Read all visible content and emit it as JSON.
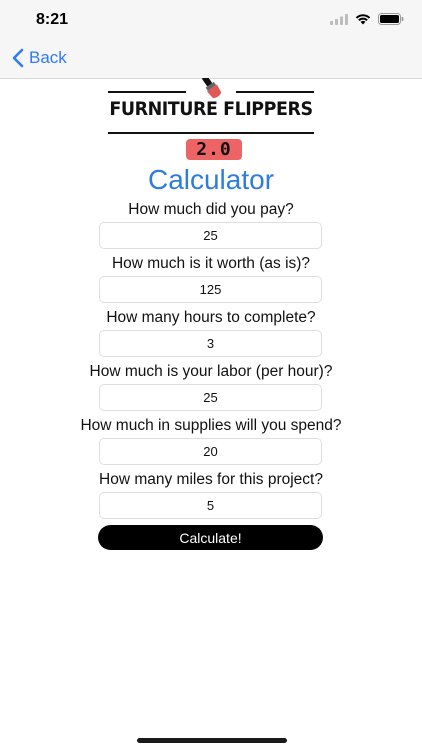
{
  "status_bar": {
    "time": "8:21",
    "icons": [
      "cellular-signal-icon",
      "wifi-icon",
      "battery-icon"
    ]
  },
  "nav": {
    "back_label": "Back"
  },
  "logo": {
    "title": "FURNITURE FLIPPERS",
    "version": "2.0"
  },
  "page": {
    "title": "Calculator"
  },
  "fields": [
    {
      "label": "How much did you pay?",
      "value": "25"
    },
    {
      "label": "How much is it worth (as is)?",
      "value": "125"
    },
    {
      "label": "How many hours to complete?",
      "value": "3"
    },
    {
      "label": "How much is your labor (per hour)?",
      "value": "25"
    },
    {
      "label": "How much in supplies will you spend?",
      "value": "20"
    },
    {
      "label": "How many miles for this project?",
      "value": "5"
    }
  ],
  "actions": {
    "calculate_label": "Calculate!"
  },
  "colors": {
    "accent": "#2f7bf5",
    "title": "#2f7ddb",
    "badge": "#ee6465",
    "button": "#000000"
  }
}
